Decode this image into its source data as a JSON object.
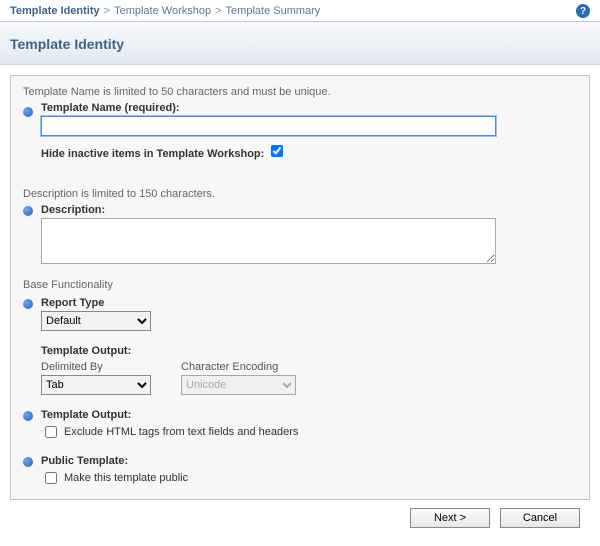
{
  "breadcrumb": {
    "current": "Template Identity",
    "items": [
      "Template Workshop",
      "Template Summary"
    ]
  },
  "header": {
    "title": "Template Identity"
  },
  "form": {
    "name_hint": "Template Name is limited to 50 characters and must be unique.",
    "name_label": "Template Name (required):",
    "name_value": "",
    "hide_inactive_label": "Hide inactive items in Template Workshop:",
    "hide_inactive_checked": true,
    "desc_hint": "Description is limited to 150 characters.",
    "desc_label": "Description:",
    "desc_value": "",
    "base_func_heading": "Base Functionality",
    "report_type_label": "Report Type",
    "report_type_value": "Default",
    "template_output_label": "Template Output:",
    "delimited_by_label": "Delimited By",
    "delimited_by_value": "Tab",
    "char_encoding_label": "Character Encoding",
    "char_encoding_value": "Unicode",
    "template_output_label2": "Template Output:",
    "exclude_html_label": "Exclude HTML tags from text fields and headers",
    "exclude_html_checked": false,
    "public_template_label": "Public Template:",
    "make_public_label": "Make this template public",
    "make_public_checked": false
  },
  "buttons": {
    "next": "Next >",
    "cancel": "Cancel"
  }
}
